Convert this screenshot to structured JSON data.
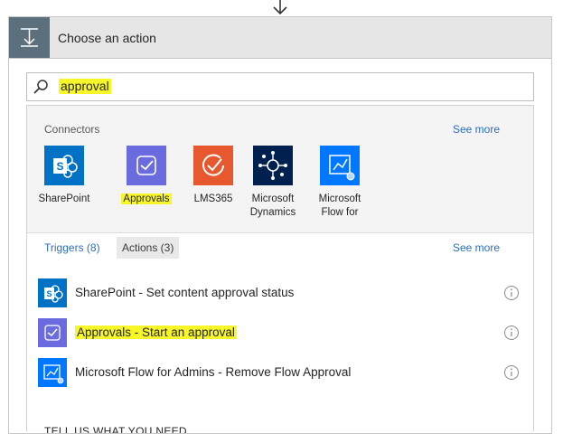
{
  "card": {
    "title": "Choose an action"
  },
  "search": {
    "value": "approval"
  },
  "connectors": {
    "label": "Connectors",
    "see_more": "See more",
    "items": [
      {
        "label": "SharePoint",
        "icon": "sharepoint-icon",
        "color": "#0072c6"
      },
      {
        "label": "Approvals",
        "icon": "approvals-icon",
        "color": "#6b6be0"
      },
      {
        "label": "LMS365",
        "icon": "lms365-icon",
        "color": "#e8582e"
      },
      {
        "label": "Microsoft Dynamics",
        "label_lines": [
          "Microsoft",
          "Dynamics"
        ],
        "icon": "dynamics-icon",
        "color": "#002050"
      },
      {
        "label": "Microsoft Flow for",
        "label_lines": [
          "Microsoft",
          "Flow for"
        ],
        "icon": "flow-icon",
        "color": "#0077ff"
      }
    ]
  },
  "tabs": {
    "triggers": "Triggers (8)",
    "actions": "Actions (3)",
    "see_more": "See more"
  },
  "actions": [
    {
      "label": "SharePoint - Set content approval status",
      "icon": "sharepoint-icon"
    },
    {
      "label": "Approvals - Start an approval",
      "icon": "approvals-icon"
    },
    {
      "label": "Microsoft Flow for Admins - Remove Flow Approval",
      "icon": "flow-icon"
    }
  ],
  "footer": {
    "tell_us": "TELL US WHAT YOU NEED"
  },
  "colors": {
    "highlight": "#f6f629",
    "link": "#2a6ebb",
    "header_bg": "#e6e6e6",
    "header_icon_bg": "#5b6f7c"
  }
}
